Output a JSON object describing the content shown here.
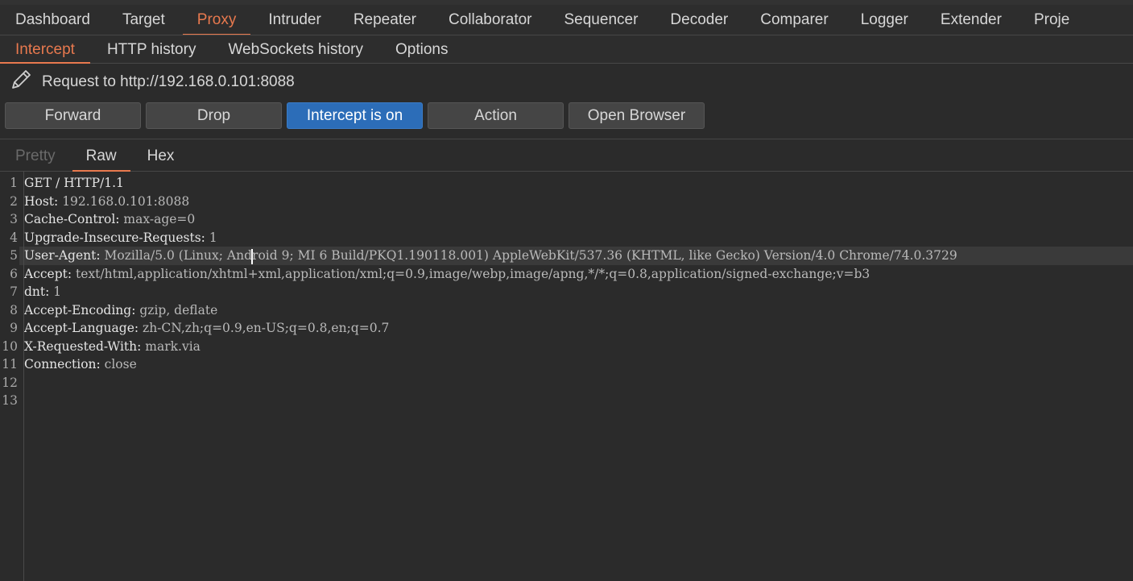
{
  "main_tabs": [
    "Dashboard",
    "Target",
    "Proxy",
    "Intruder",
    "Repeater",
    "Collaborator",
    "Sequencer",
    "Decoder",
    "Comparer",
    "Logger",
    "Extender",
    "Proje"
  ],
  "main_active": "Proxy",
  "sub_tabs": [
    "Intercept",
    "HTTP history",
    "WebSockets history",
    "Options"
  ],
  "sub_active": "Intercept",
  "request_label": "Request to http://192.168.0.101:8088",
  "buttons": {
    "forward": "Forward",
    "drop": "Drop",
    "intercept": "Intercept is on",
    "action": "Action",
    "open_browser": "Open Browser"
  },
  "editor_tabs": [
    "Pretty",
    "Raw",
    "Hex"
  ],
  "editor_active": "Raw",
  "request_lines": [
    {
      "n": "1",
      "name": "GET / HTTP/1.1",
      "value": ""
    },
    {
      "n": "2",
      "name": "Host:",
      "value": " 192.168.0.101:8088"
    },
    {
      "n": "3",
      "name": "Cache-Control:",
      "value": " max-age=0"
    },
    {
      "n": "4",
      "name": "Upgrade-Insecure-Requests:",
      "value": " 1"
    },
    {
      "n": "5",
      "name": "User-Agent:",
      "value_before_cursor": " Mozilla/5.0 (Linux; And",
      "value_after_cursor": "roid 9; MI 6 Build/PKQ1.190118.001) AppleWebKit/537.36 (KHTML, like Gecko) Version/4.0 Chrome/74.0.3729"
    },
    {
      "n": "6",
      "name": "Accept:",
      "value": " text/html,application/xhtml+xml,application/xml;q=0.9,image/webp,image/apng,*/*;q=0.8,application/signed-exchange;v=b3"
    },
    {
      "n": "7",
      "name": "dnt:",
      "value": " 1"
    },
    {
      "n": "8",
      "name": "Accept-Encoding:",
      "value": " gzip, deflate"
    },
    {
      "n": "9",
      "name": "Accept-Language:",
      "value": " zh-CN,zh;q=0.9,en-US;q=0.8,en;q=0.7"
    },
    {
      "n": "10",
      "name": "X-Requested-With:",
      "value": " mark.via"
    },
    {
      "n": "11",
      "name": "Connection:",
      "value": " close"
    },
    {
      "n": "12",
      "name": "",
      "value": ""
    },
    {
      "n": "13",
      "name": "",
      "value": ""
    }
  ],
  "colors": {
    "accent": "#e8794e",
    "primary_button": "#2c6db8",
    "background": "#2b2b2b"
  }
}
